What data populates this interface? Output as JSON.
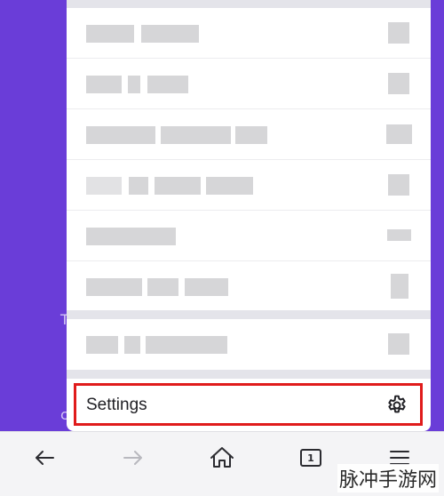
{
  "background": {
    "color": "#6a3dd8",
    "fragments": [
      "T",
      "c"
    ]
  },
  "menu": {
    "redacted_rows": 7,
    "settings": {
      "label": "Settings",
      "icon": "gear-icon",
      "highlight_color": "#e01b1b"
    }
  },
  "toolbar": {
    "back_icon": "arrow-left-icon",
    "forward_icon": "arrow-right-icon",
    "home_icon": "home-icon",
    "tabs_count": "1",
    "menu_icon": "hamburger-icon"
  },
  "watermark": {
    "text": "脉冲手游网"
  }
}
